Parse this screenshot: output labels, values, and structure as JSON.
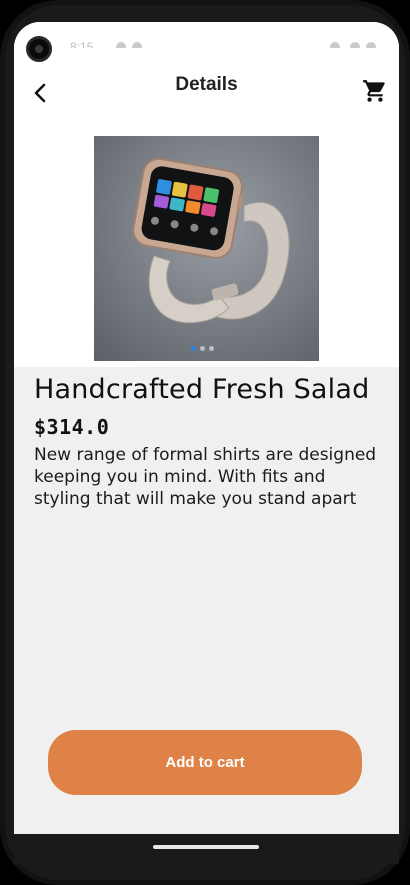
{
  "status_bar": {
    "time": "8:15"
  },
  "header": {
    "title": "Details"
  },
  "icons": {
    "back": "chevron-left-icon",
    "cart": "shopping-cart-icon"
  },
  "product": {
    "image_alt": "smartwatch",
    "carousel": {
      "count": 3,
      "active": 0
    },
    "name": "Handcrafted Fresh Salad",
    "price": "$314.0",
    "description": "New range of formal shirts are designed keeping you in mind. With fits and styling that will make you stand apart"
  },
  "actions": {
    "add_to_cart": "Add to cart"
  },
  "colors": {
    "accent": "#df8248",
    "dot_active": "#2f7de1",
    "background": "#f0f0f0"
  }
}
